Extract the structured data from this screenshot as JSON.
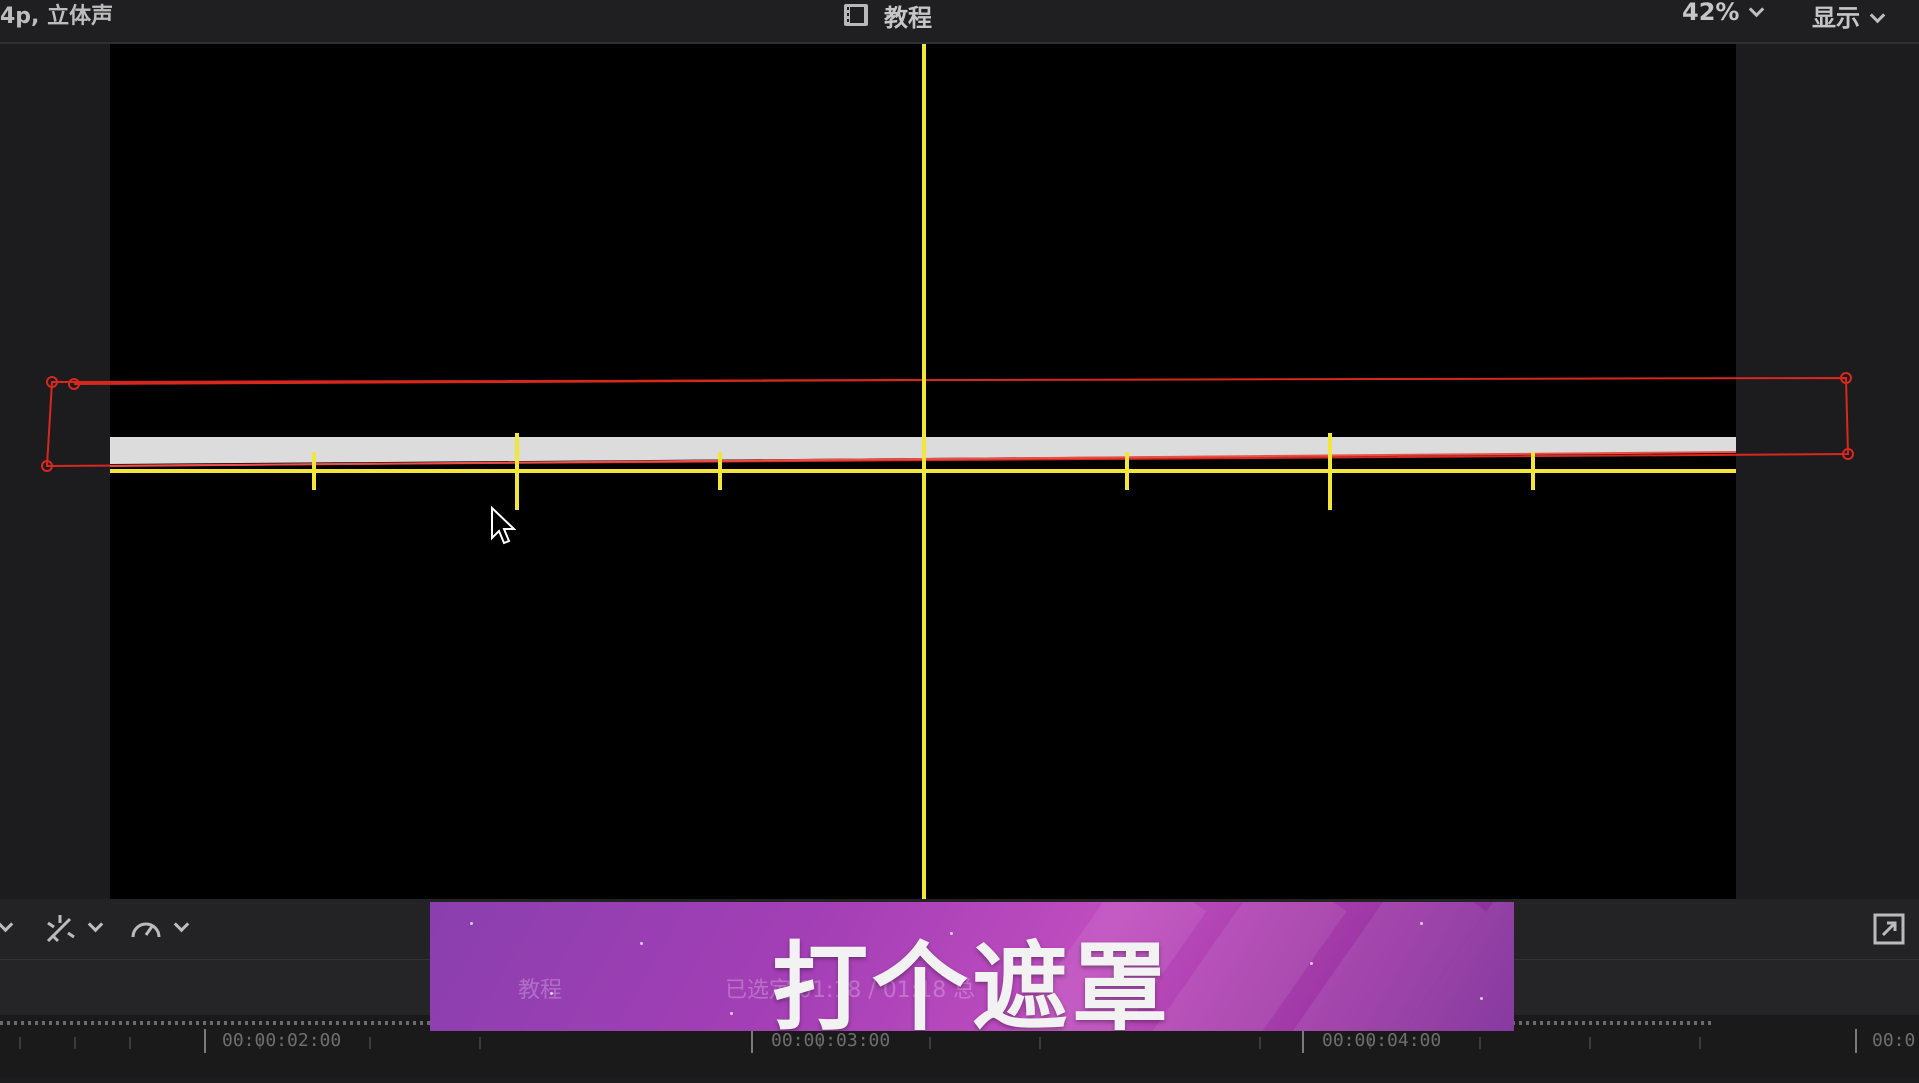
{
  "topbar": {
    "format_text": "4p, 立体声",
    "title": "教程",
    "zoom": "42%",
    "display_label": "显示"
  },
  "icons": {
    "title_icon": "clip-icon",
    "transform_tool": "transform-icon",
    "speed_tool": "speed-icon",
    "fullscreen": "fullscreen-icon",
    "pointer": "mouse-cursor-icon"
  },
  "banner": {
    "caption": "打个遮罩",
    "ghost_title": "教程",
    "ghost_time": "已选定 01:18 / 01:18 总"
  },
  "timeline": {
    "timecodes": [
      "00:00:02:00",
      "00:00:03:00",
      "00:00:04:00",
      "00:0"
    ]
  },
  "colors": {
    "guide_yellow": "#f2e63a",
    "mask_red": "#d8281e",
    "banner_purple": "#a43fb6"
  }
}
